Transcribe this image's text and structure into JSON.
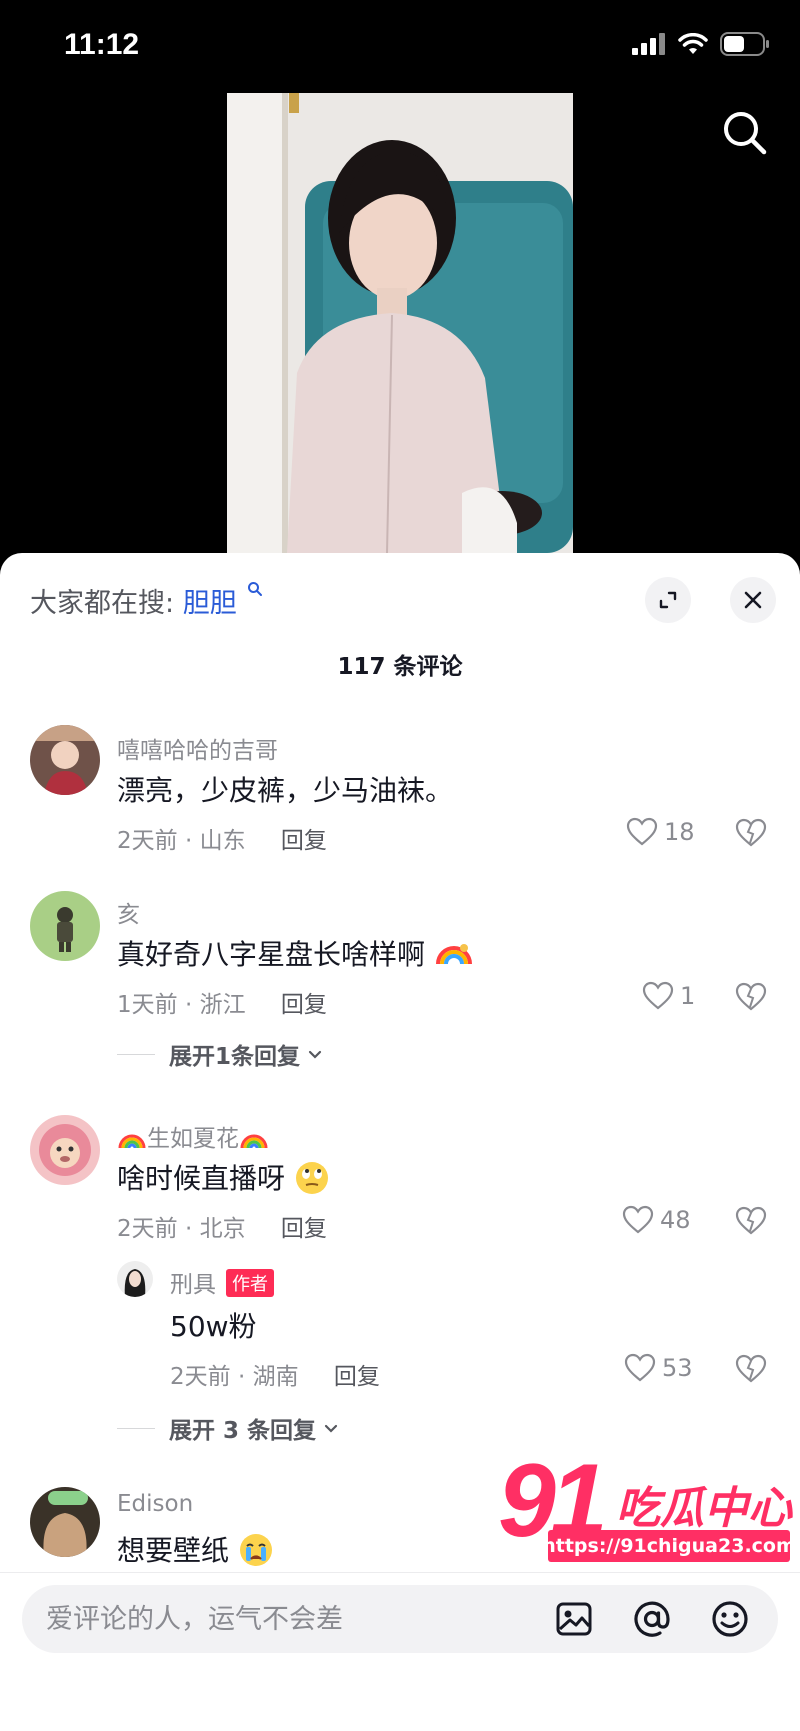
{
  "status_bar": {
    "time": "11:12"
  },
  "sheet": {
    "hot_search_prefix": "大家都在搜:",
    "hot_search_keyword": "胆胆",
    "comment_count": "117 条评论"
  },
  "comments": [
    {
      "user": "嘻嘻哈哈的吉哥",
      "text": "漂亮，少皮裤，少马油袜。",
      "time_loc": "2天前 · 山东",
      "reply": "回复",
      "likes": "18"
    },
    {
      "user": "亥",
      "text": "真好奇八字星盘长啥样啊",
      "time_loc": "1天前 · 浙江",
      "reply": "回复",
      "likes": "1",
      "expand": "展开1条回复"
    },
    {
      "user": "生如夏花",
      "text": "啥时候直播呀",
      "time_loc": "2天前 · 北京",
      "reply": "回复",
      "likes": "48",
      "sub_reply": {
        "user": "刑具",
        "badge": "作者",
        "text": "50w粉",
        "time_loc": "2天前 · 湖南",
        "reply": "回复",
        "likes": "53"
      },
      "expand": "展开 3 条回复"
    },
    {
      "user": "Edison",
      "text": "想要壁纸"
    }
  ],
  "watermark": {
    "brand_number": "91",
    "brand_text": "吃瓜中心",
    "url": "https://91chigua23.com"
  },
  "input": {
    "placeholder": "爱评论的人，运气不会差"
  },
  "colors": {
    "accent": "#fe2c55",
    "keyword": "#2a5bd7",
    "watermark": "#ff2f64"
  }
}
